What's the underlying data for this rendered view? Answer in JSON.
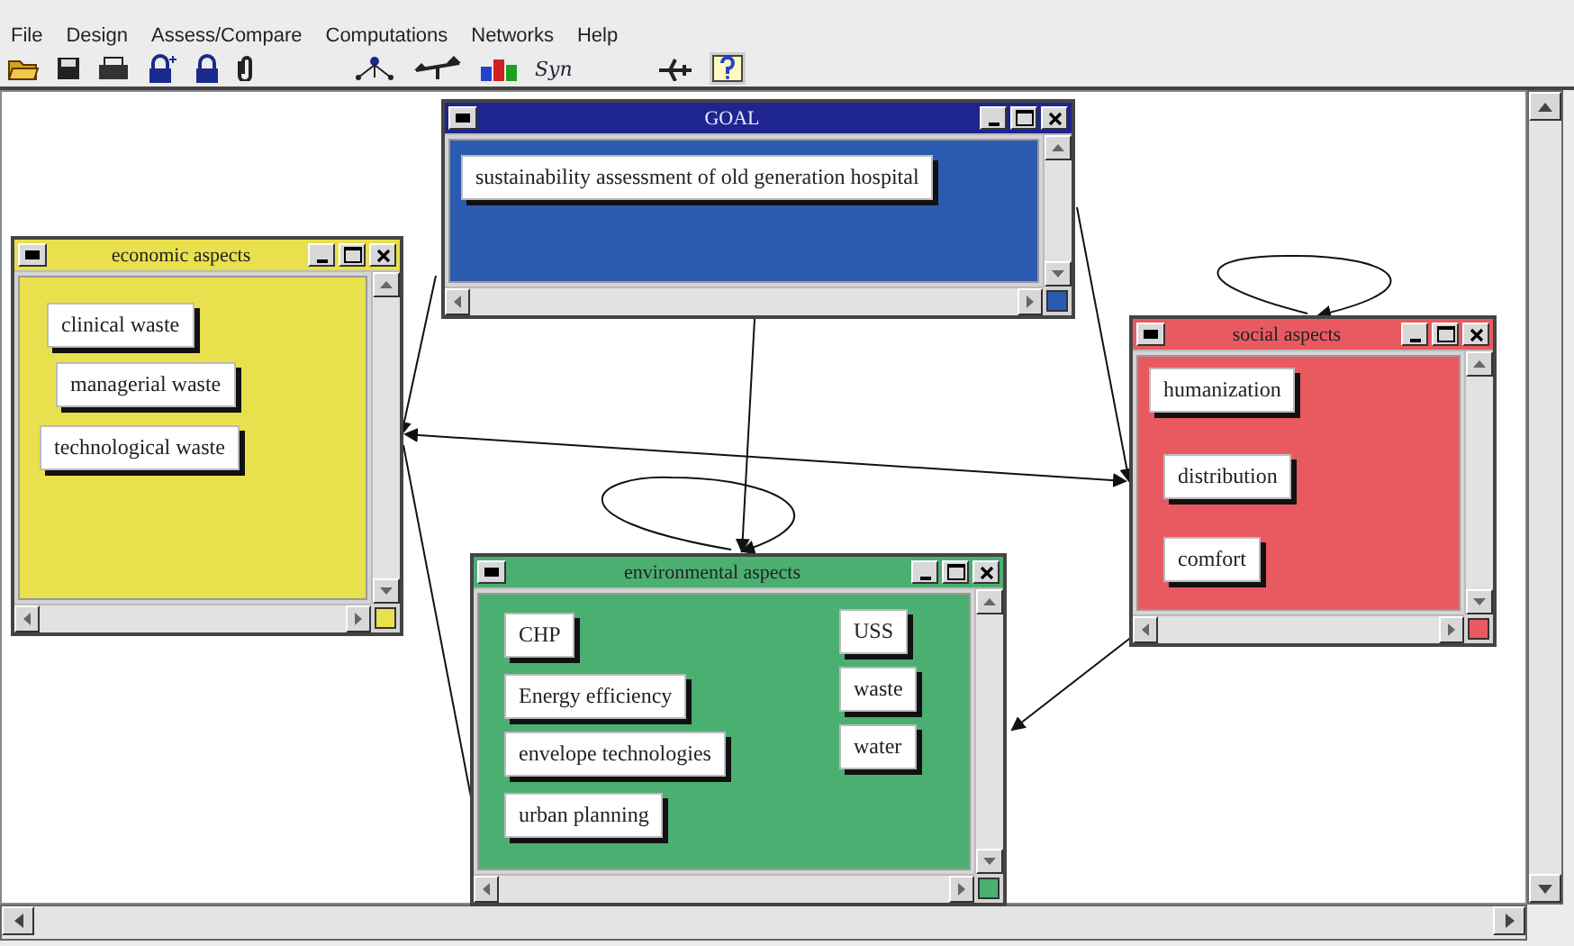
{
  "menu": [
    "File",
    "Design",
    "Assess/Compare",
    "Computations",
    "Networks",
    "Help"
  ],
  "toolbar": {
    "syn_label": "Syn"
  },
  "clusters": [
    {
      "title": "GOAL",
      "active": true,
      "color": "#2b5bb0",
      "nodes": [
        "sustainability assessment of old generation hospital"
      ]
    },
    {
      "title": "economic aspects",
      "active": false,
      "color": "#e8e04c",
      "nodes": [
        "clinical waste",
        "managerial waste",
        "technological waste"
      ]
    },
    {
      "title": "social aspects",
      "active": false,
      "color": "#e85a60",
      "nodes": [
        "humanization",
        "distribution",
        "comfort"
      ]
    },
    {
      "title": "environmental aspects",
      "active": false,
      "color": "#4caf72",
      "nodes": [
        "CHP",
        "Energy efficiency",
        "envelope technologies",
        "urban planning",
        "USS",
        "waste",
        "water"
      ]
    }
  ]
}
